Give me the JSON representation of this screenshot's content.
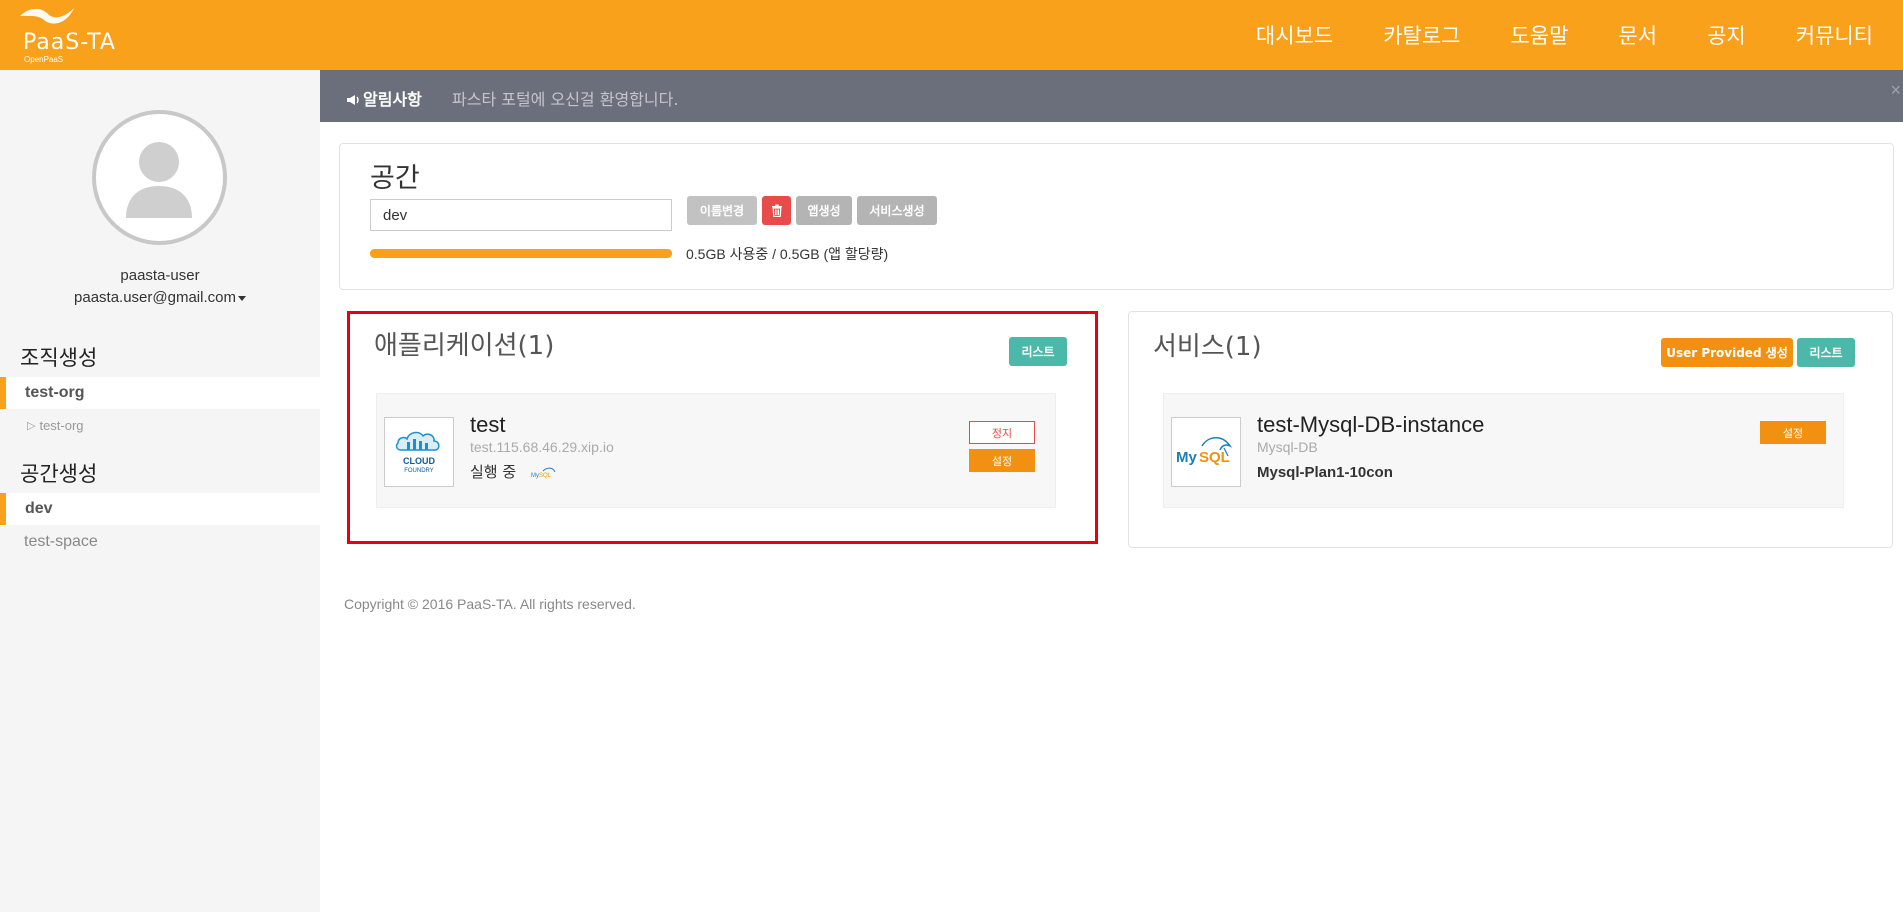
{
  "header": {
    "logo_text": "PaaS-TA",
    "logo_sub": "OpenPaaS",
    "nav": [
      "대시보드",
      "카탈로그",
      "도움말",
      "문서",
      "공지",
      "커뮤니티"
    ]
  },
  "sidebar": {
    "user_name": "paasta-user",
    "user_email": "paasta.user@gmail.com",
    "org_heading": "조직생성",
    "org_active": "test-org",
    "org_sub": "test-org",
    "space_heading": "공간생성",
    "space_active": "dev",
    "space_other": "test-space"
  },
  "notice": {
    "label": "알림사항",
    "text": "파스타 포털에 오신걸 환영합니다.",
    "close": "×"
  },
  "space": {
    "title": "공간",
    "name_value": "dev",
    "rename_label": "이름변경",
    "delete_icon": "trash-icon",
    "create_app_label": "앱생성",
    "create_service_label": "서비스생성",
    "usage_text": "0.5GB 사용중 / 0.5GB (앱 할당량)",
    "usage_fraction": 1.0
  },
  "applications": {
    "title": "애플리케이션(1)",
    "list_label": "리스트",
    "items": [
      {
        "name": "test",
        "url": "test.115.68.46.29.xip.io",
        "status": "실행 중",
        "logo": "cloud-foundry-logo",
        "stop_label": "정지",
        "settings_label": "설정"
      }
    ]
  },
  "services": {
    "title": "서비스(1)",
    "user_provided_label": "User Provided 생성",
    "list_label": "리스트",
    "items": [
      {
        "name": "test-Mysql-DB-instance",
        "type": "Mysql-DB",
        "plan": "Mysql-Plan1-10con",
        "logo": "mysql-logo",
        "settings_label": "설정"
      }
    ]
  },
  "footer": {
    "copyright": "Copyright © 2016 PaaS-TA. All rights reserved."
  },
  "colors": {
    "brand_orange": "#f9a11b",
    "teal": "#4bb8a9",
    "red": "#e94b4b",
    "gray_button": "#b4b4b4",
    "notice_bg": "#6b6f7b",
    "highlight": "#e60012"
  }
}
